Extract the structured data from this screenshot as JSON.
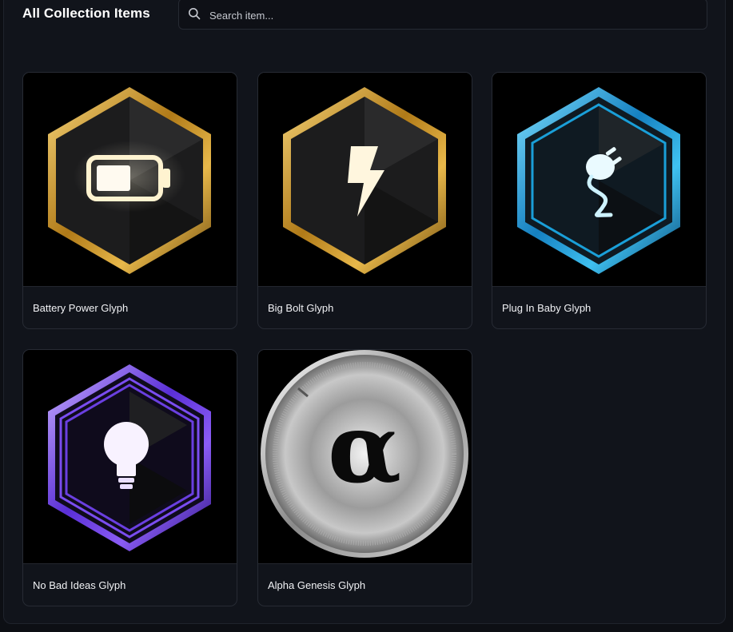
{
  "header": {
    "title": "All Collection Items",
    "search_placeholder": "Search item..."
  },
  "items": [
    {
      "name": "Battery Power Glyph",
      "icon": "battery-icon",
      "frame_color": "#d4a23a"
    },
    {
      "name": "Big Bolt Glyph",
      "icon": "lightning-bolt-icon",
      "frame_color": "#d4a23a"
    },
    {
      "name": "Plug In Baby Glyph",
      "icon": "plug-icon",
      "frame_color": "#2aa8e0"
    },
    {
      "name": "No Bad Ideas Glyph",
      "icon": "lightbulb-icon",
      "frame_color": "#7a4df0"
    },
    {
      "name": "Alpha Genesis Glyph",
      "icon": "alpha-coin-icon",
      "frame_color": "#c9c9c9",
      "symbol": "α"
    }
  ]
}
